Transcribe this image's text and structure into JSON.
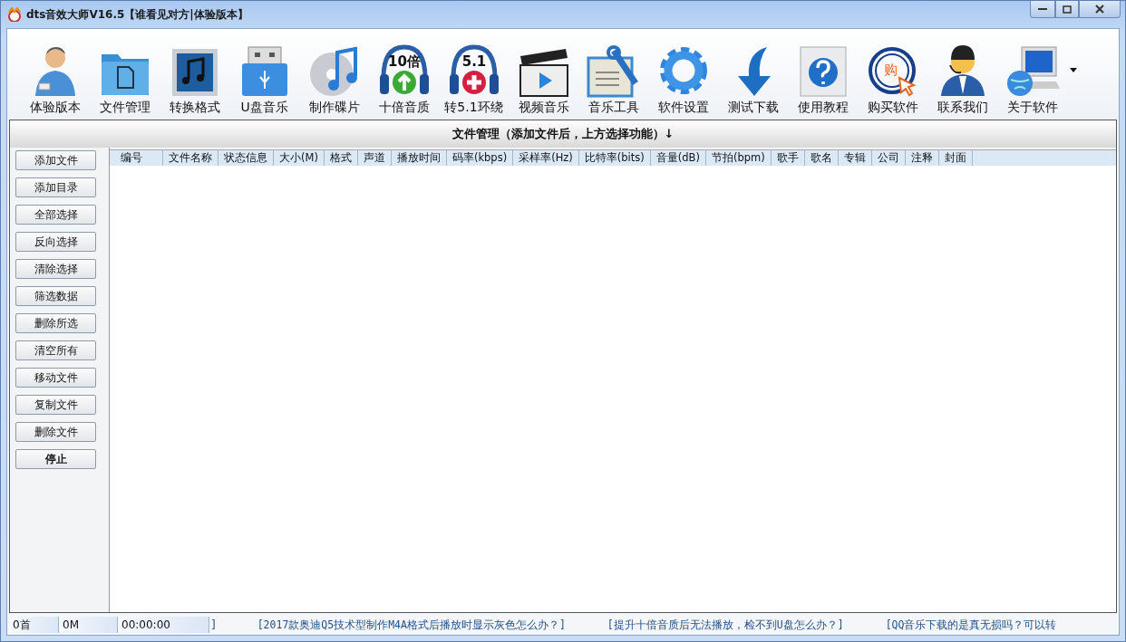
{
  "window": {
    "title": "dts音效大师V16.5【谁看见对方|体验版本】"
  },
  "toolbar": [
    {
      "label": "体验版本"
    },
    {
      "label": "文件管理"
    },
    {
      "label": "转换格式"
    },
    {
      "label": "U盘音乐"
    },
    {
      "label": "制作碟片"
    },
    {
      "label": "十倍音质",
      "badge": "10倍"
    },
    {
      "label": "转5.1环绕",
      "badge": "5.1"
    },
    {
      "label": "视频音乐"
    },
    {
      "label": "音乐工具"
    },
    {
      "label": "软件设置"
    },
    {
      "label": "测试下载"
    },
    {
      "label": "使用教程"
    },
    {
      "label": "购买软件",
      "badge": "购"
    },
    {
      "label": "联系我们"
    },
    {
      "label": "关于软件"
    }
  ],
  "panel_title": "文件管理（添加文件后，上方选择功能）↓",
  "button_groups": [
    [
      "添加文件",
      "添加目录"
    ],
    [
      "全部选择",
      "反向选择",
      "清除选择"
    ],
    [
      "筛选数据",
      "删除所选",
      "清空所有"
    ],
    [
      "移动文件",
      "复制文件",
      "删除文件"
    ],
    [
      "停止"
    ]
  ],
  "table": {
    "columns": [
      "编号",
      "文件名称",
      "状态信息",
      "大小(M)",
      "格式",
      "声道",
      "播放时间",
      "码率(kbps)",
      "采样率(Hz)",
      "比特率(bits)",
      "音量(dB)",
      "节拍(bpm)",
      "歌手",
      "歌名",
      "专辑",
      "公司",
      "注释",
      "封面"
    ]
  },
  "status_bar": {
    "count": "0首",
    "size": "0M",
    "time": "00:00:00",
    "bracket": "]",
    "tips": [
      "[2017款奥迪Q5技术型制作M4A格式后播放时显示灰色怎么办？]",
      "[提升十倍音质后无法播放，检不到U盘怎么办？]",
      "[QQ音乐下载的是真无损吗？可以转"
    ]
  }
}
